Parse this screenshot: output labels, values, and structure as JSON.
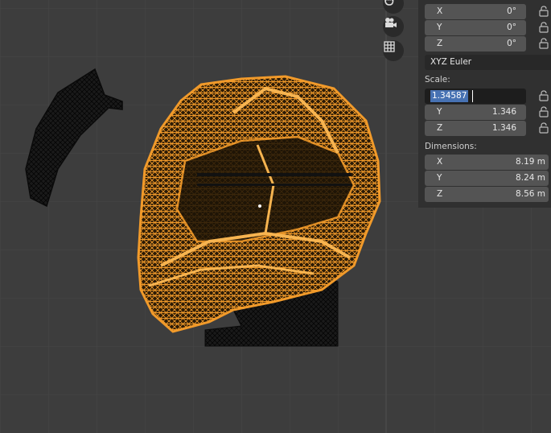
{
  "rotation": {
    "x_label": "X",
    "x_value": "0°",
    "y_label": "Y",
    "y_value": "0°",
    "z_label": "Z",
    "z_value": "0°",
    "mode": "XYZ Euler"
  },
  "scale": {
    "title": "Scale:",
    "x_editing_value": "1.34587",
    "y_label": "Y",
    "y_value": "1.346",
    "z_label": "Z",
    "z_value": "1.346"
  },
  "dimensions": {
    "title": "Dimensions:",
    "x_label": "X",
    "x_value": "8.19 m",
    "y_label": "Y",
    "y_value": "8.24 m",
    "z_label": "Z",
    "z_value": "8.56 m"
  },
  "viewport": {
    "nav_icons": [
      "hand-pan-icon",
      "camera-icon",
      "grid-icon"
    ],
    "selection_color": "#f19a2a",
    "mesh_color": "#111111",
    "background_color": "#3d3d3d"
  }
}
